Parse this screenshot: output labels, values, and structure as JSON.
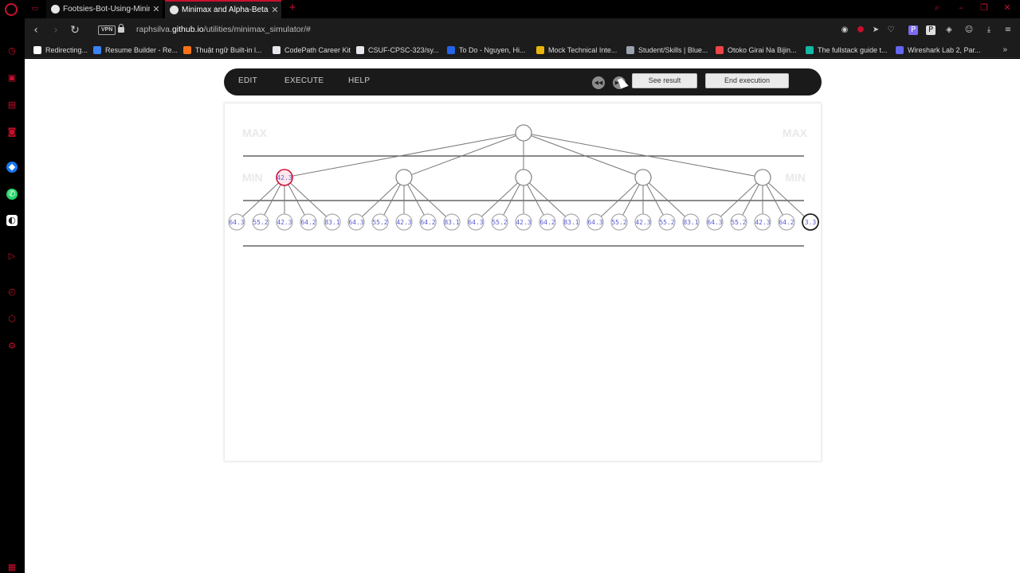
{
  "browser": {
    "tabs": [
      {
        "title": "Footsies-Bot-Using-Minimax",
        "active": false
      },
      {
        "title": "Minimax and Alpha-Beta P",
        "active": true
      }
    ],
    "new_tab_glyph": "+",
    "url_prefix": "raphsilva.",
    "url_host": "github.io",
    "url_path": "/utilities/minimax_simulator/#",
    "vpn_label": "VPN",
    "bookmarks": [
      {
        "label": "Redirecting...",
        "color": "#ffffff"
      },
      {
        "label": "Resume Builder - Re...",
        "color": "#3b82f6"
      },
      {
        "label": "Thuật ngữ Built-in l...",
        "color": "#f97316"
      },
      {
        "label": "CodePath Career Kit",
        "color": "#e5e7eb"
      },
      {
        "label": "CSUF-CPSC-323/sy...",
        "color": "#e5e7eb"
      },
      {
        "label": "To Do - Nguyen, Hi...",
        "color": "#2563eb"
      },
      {
        "label": "Mock Technical Inte...",
        "color": "#eab308"
      },
      {
        "label": "Student/Skills | Blue...",
        "color": "#9ca3af"
      },
      {
        "label": "Otoko Girai Na Bijin...",
        "color": "#ef4444"
      },
      {
        "label": "The fullstack guide t...",
        "color": "#14b8a6"
      },
      {
        "label": "Wireshark Lab 2, Par...",
        "color": "#6366f1"
      }
    ],
    "accent_color": "#c8102e"
  },
  "toolbar": {
    "edit_label": "EDIT",
    "execute_label": "EXECUTE",
    "help_label": "HELP",
    "see_result_label": "See result",
    "end_execution_label": "End execution"
  },
  "tree": {
    "max_label": "MAX",
    "min_label": "MIN",
    "min_nodes": [
      {
        "value": "42.3",
        "state": "current"
      },
      {
        "value": "",
        "state": "idle"
      },
      {
        "value": "",
        "state": "idle"
      },
      {
        "value": "",
        "state": "idle"
      },
      {
        "value": "",
        "state": "idle"
      }
    ],
    "leaf_values": [
      "64.3",
      "55.2",
      "42.3",
      "64.2",
      "83.1",
      "64.3",
      "55.2",
      "42.3",
      "64.2",
      "83.1",
      "64.3",
      "55.2",
      "42.3",
      "64.2",
      "83.1",
      "64.3",
      "55.2",
      "42.3",
      "55.2",
      "83.1",
      "64.3",
      "55.2",
      "42.3",
      "64.2",
      "3.3"
    ],
    "leaf_states": [
      "visited",
      "visited",
      "visited",
      "visited",
      "visited",
      "visited",
      "visited",
      "visited",
      "visited",
      "visited",
      "visited",
      "visited",
      "visited",
      "visited",
      "visited",
      "visited",
      "visited",
      "visited",
      "visited",
      "visited",
      "visited",
      "visited",
      "visited",
      "visited",
      "selected"
    ]
  }
}
